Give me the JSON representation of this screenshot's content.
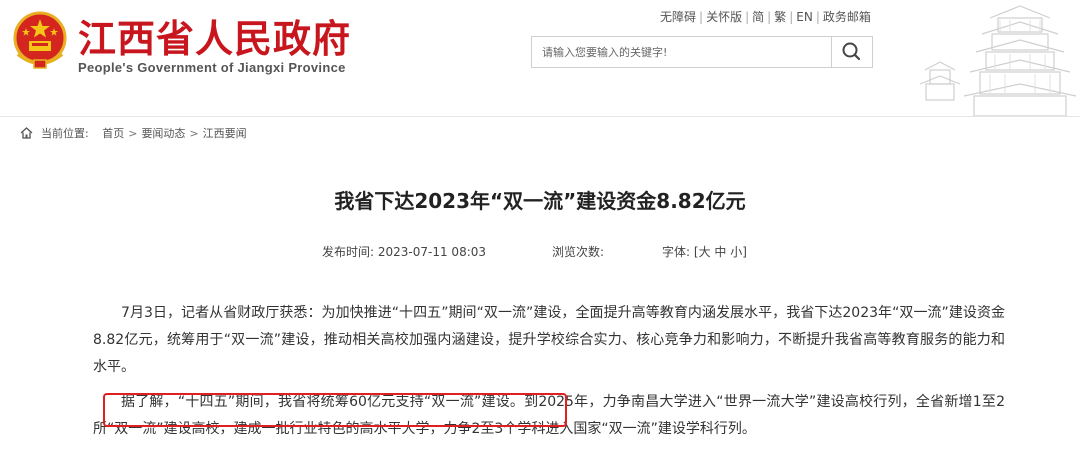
{
  "header": {
    "title": "江西省人民政府",
    "subtitle": "People's Government of Jiangxi Province",
    "links": [
      "无障碍",
      "关怀版",
      "简",
      "繁",
      "EN",
      "政务邮箱"
    ],
    "search_placeholder": "请输入您要输入的关键字!"
  },
  "breadcrumb": {
    "label": "当前位置:",
    "items": [
      "首页",
      "要闻动态",
      "江西要闻"
    ],
    "arrow": ">"
  },
  "article": {
    "title": "我省下达2023年“双一流”建设资金8.82亿元",
    "publish_label": "发布时间:",
    "publish_time": "2023-07-11 08:03",
    "views_label": "浏览次数:",
    "font_label": "字体:",
    "font_open": "[",
    "font_large": "大",
    "font_medium": "中",
    "font_small": "小",
    "font_close": "]",
    "para1": "7月3日，记者从省财政厅获悉：为加快推进“十四五”期间“双一流”建设，全面提升高等教育内涵发展水平，我省下达2023年“双一流”建设资金8.82亿元，统筹用于“双一流”建设，推动相关高校加强内涵建设，提升学校综合实力、核心竞争力和影响力，不断提升我省高等教育服务的能力和水平。",
    "para2_highlight": "据了解，“十四五”期间，我省将统筹60亿元支持“双一流”建设。",
    "para2_rest": "到2025年，力争南昌大学进入“世界一流大学”建设高校行列，全省新增1至2所“双一流”建设高校，建成一批行业特色的高水平大学，力争2至3个学科进入国家“双一流”建设学科行列。"
  },
  "colors": {
    "brand_red": "#c8161e",
    "highlight_border": "#e02020"
  }
}
